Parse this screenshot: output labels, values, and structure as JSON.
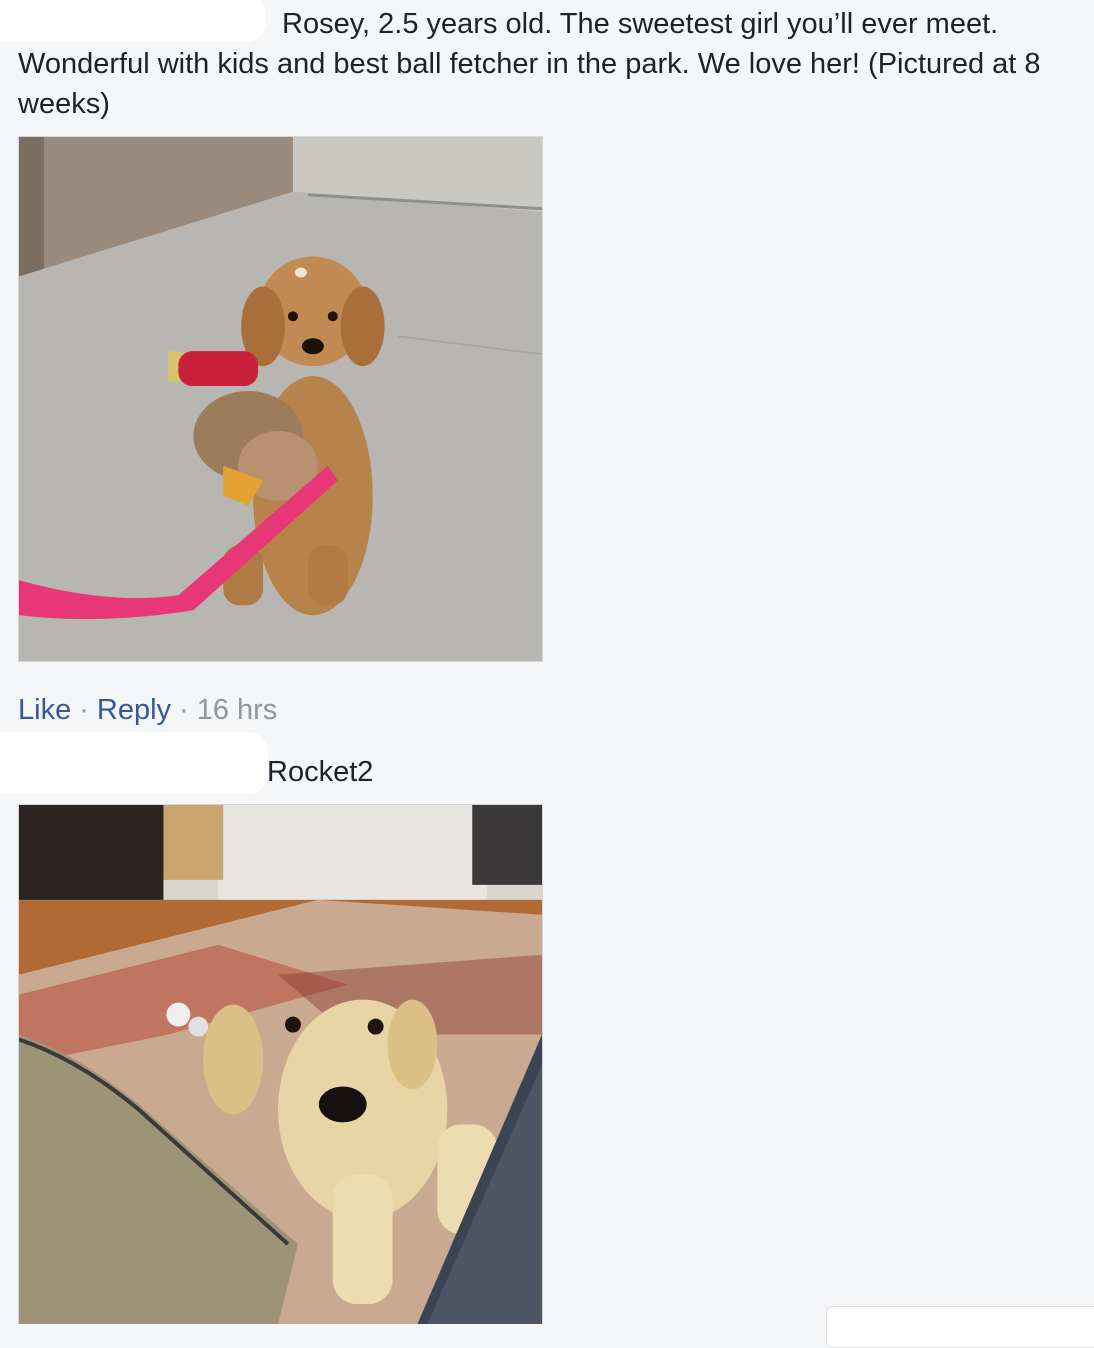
{
  "comments": [
    {
      "text": "Rosey, 2.5 years old. The sweetest girl you’ll ever meet. Wonderful with kids and best ball fetcher in the park. We love her! (Pictured at 8 weeks)",
      "photo_alt": "Golden retriever puppy sitting on pavement holding a stuffed toy, pink leash",
      "actions": {
        "like": "Like",
        "reply": "Reply",
        "separator": "·",
        "time": "16 hrs"
      }
    },
    {
      "text": "Rocket2",
      "photo_alt": "Yellow labrador puppy peeking over a couch onto a patterned rug"
    }
  ],
  "colors": {
    "background": "#f5f6f7",
    "link": "#365899",
    "meta": "#90949c",
    "text": "#1d2129"
  }
}
